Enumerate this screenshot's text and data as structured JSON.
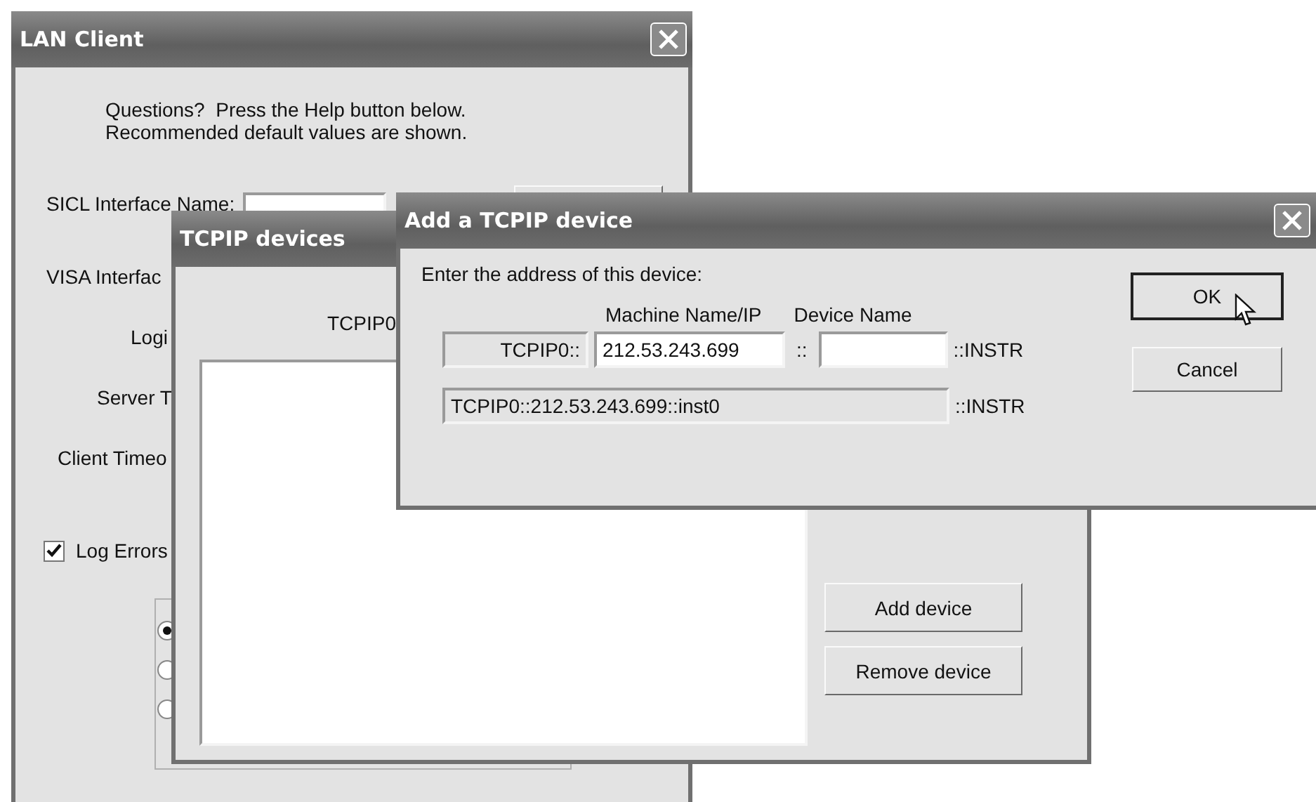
{
  "lan_client": {
    "title": "LAN Client",
    "intro": "Questions?  Press the Help button below.\nRecommended default values are shown.",
    "sicl": {
      "label": "SICL Interface Name:"
    },
    "labels": [
      "VISA Interfac",
      "Logi",
      "Server T",
      "Client Timeo"
    ],
    "log_errors": {
      "label": "Log Errors",
      "checked": true
    },
    "radios": [
      {
        "selected": true
      },
      {
        "selected": false
      },
      {
        "selected": false
      }
    ]
  },
  "tcpip_devices": {
    "title": "TCPIP devices",
    "column": "TCPIP0",
    "buttons": [
      "Add device",
      "Remove device"
    ]
  },
  "add_device": {
    "title": "Add a TCPIP device",
    "prompt": "Enter the address of this device:",
    "machine_label": "Machine Name/IP",
    "device_label": "Device Name",
    "prefix": "TCPIP0::",
    "machine_value": "212.53.243.699",
    "separator": "::",
    "suffix": "::INSTR",
    "result": "TCPIP0::212.53.243.699::inst0",
    "result_suffix": "::INSTR",
    "buttons": [
      {
        "label": "OK",
        "default": true
      },
      {
        "label": "Cancel",
        "default": false
      }
    ]
  }
}
